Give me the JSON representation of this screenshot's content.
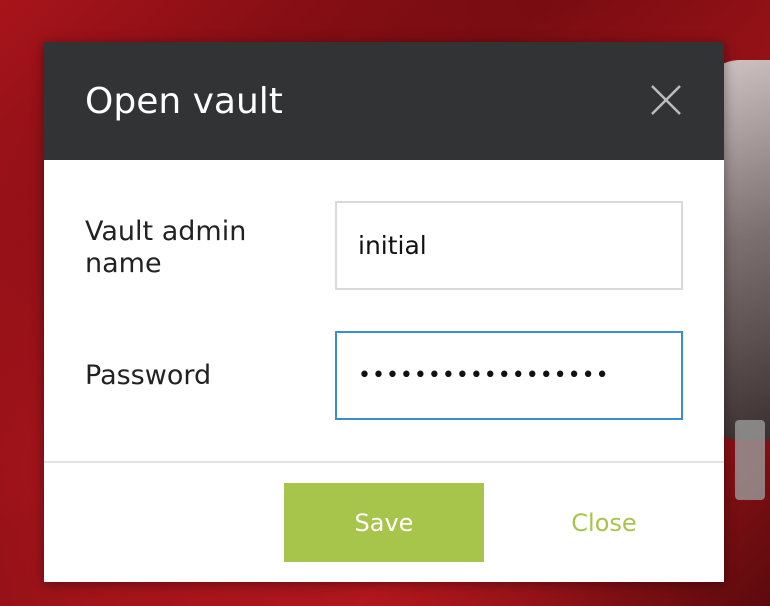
{
  "dialog": {
    "title": "Open vault",
    "close_icon": "close-icon"
  },
  "form": {
    "name_label": "Vault admin name",
    "name_value": "initial",
    "password_label": "Password",
    "password_value": "••••••••••••••••••"
  },
  "footer": {
    "save_label": "Save",
    "close_label": "Close"
  },
  "colors": {
    "header_bg": "#323335",
    "accent": "#a7c44b",
    "focus_border": "#3b8fd0"
  }
}
